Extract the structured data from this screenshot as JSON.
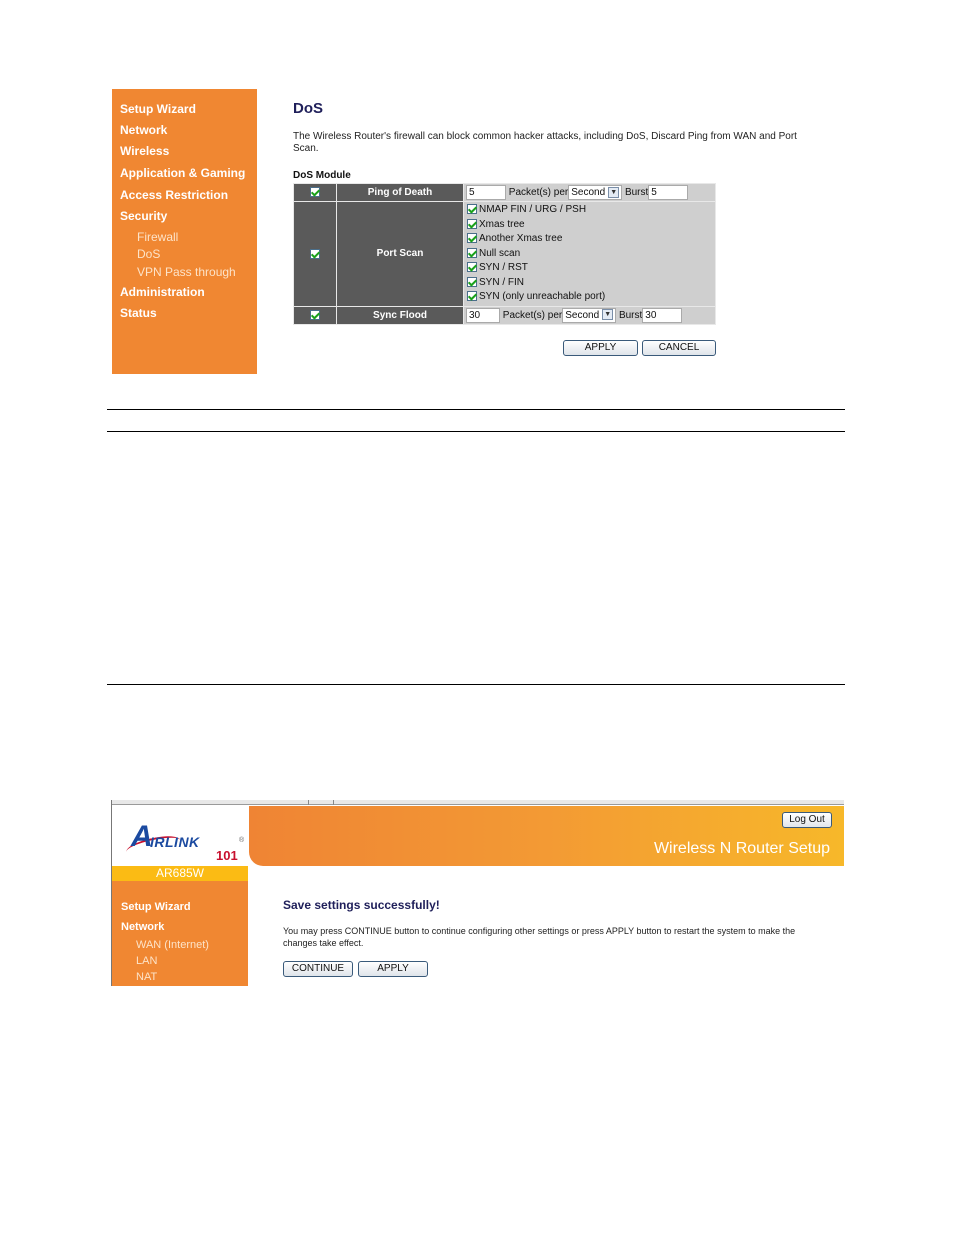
{
  "dos_screen": {
    "sidebar": {
      "items": [
        {
          "label": "Setup Wizard"
        },
        {
          "label": "Network"
        },
        {
          "label": "Wireless"
        },
        {
          "label": "Application & Gaming"
        },
        {
          "label": "Access Restriction"
        },
        {
          "label": "Security"
        },
        {
          "label": "Administration"
        },
        {
          "label": "Status"
        }
      ],
      "security_subitems": [
        {
          "label": "Firewall"
        },
        {
          "label": "DoS"
        },
        {
          "label": "VPN Pass through"
        }
      ]
    },
    "title": "DoS",
    "description": "The Wireless Router's firewall can block common hacker attacks, including DoS, Discard Ping from WAN and Port Scan.",
    "module_heading": "DoS Module",
    "rows": {
      "ping_of_death": {
        "label": "Ping of Death",
        "enabled": true,
        "packets": "5",
        "packets_per_label": "Packet(s) per",
        "unit": "Second",
        "burst_label": "Burst",
        "burst": "5"
      },
      "port_scan": {
        "label": "Port Scan",
        "enabled": true,
        "options": [
          {
            "label": "NMAP FIN / URG / PSH",
            "checked": true
          },
          {
            "label": "Xmas tree",
            "checked": true
          },
          {
            "label": "Another Xmas tree",
            "checked": true
          },
          {
            "label": "Null scan",
            "checked": true
          },
          {
            "label": "SYN / RST",
            "checked": true
          },
          {
            "label": "SYN / FIN",
            "checked": true
          },
          {
            "label": "SYN (only unreachable port)",
            "checked": true
          }
        ]
      },
      "sync_flood": {
        "label": "Sync Flood",
        "enabled": true,
        "packets": "30",
        "packets_per_label": "Packet(s) per",
        "unit": "Second",
        "burst_label": "Burst",
        "burst": "30"
      }
    },
    "buttons": {
      "apply": "APPLY",
      "cancel": "CANCEL"
    }
  },
  "save_screen": {
    "logo": {
      "brand_a": "A",
      "brand_rest": "IRLINK",
      "brand_number": "101",
      "registered": "®"
    },
    "banner_title": "Wireless N Router Setup",
    "logout_label": "Log Out",
    "model": "AR685W",
    "sidebar": {
      "items": [
        {
          "label": "Setup Wizard"
        },
        {
          "label": "Network"
        }
      ],
      "network_subitems": [
        {
          "label": "WAN (Internet)"
        },
        {
          "label": "LAN"
        },
        {
          "label": "NAT"
        }
      ]
    },
    "title": "Save settings successfully!",
    "description": "You may press CONTINUE button to continue configuring other settings or press APPLY button to restart the system to make the changes take effect.",
    "buttons": {
      "continue": "CONTINUE",
      "apply": "APPLY"
    }
  }
}
